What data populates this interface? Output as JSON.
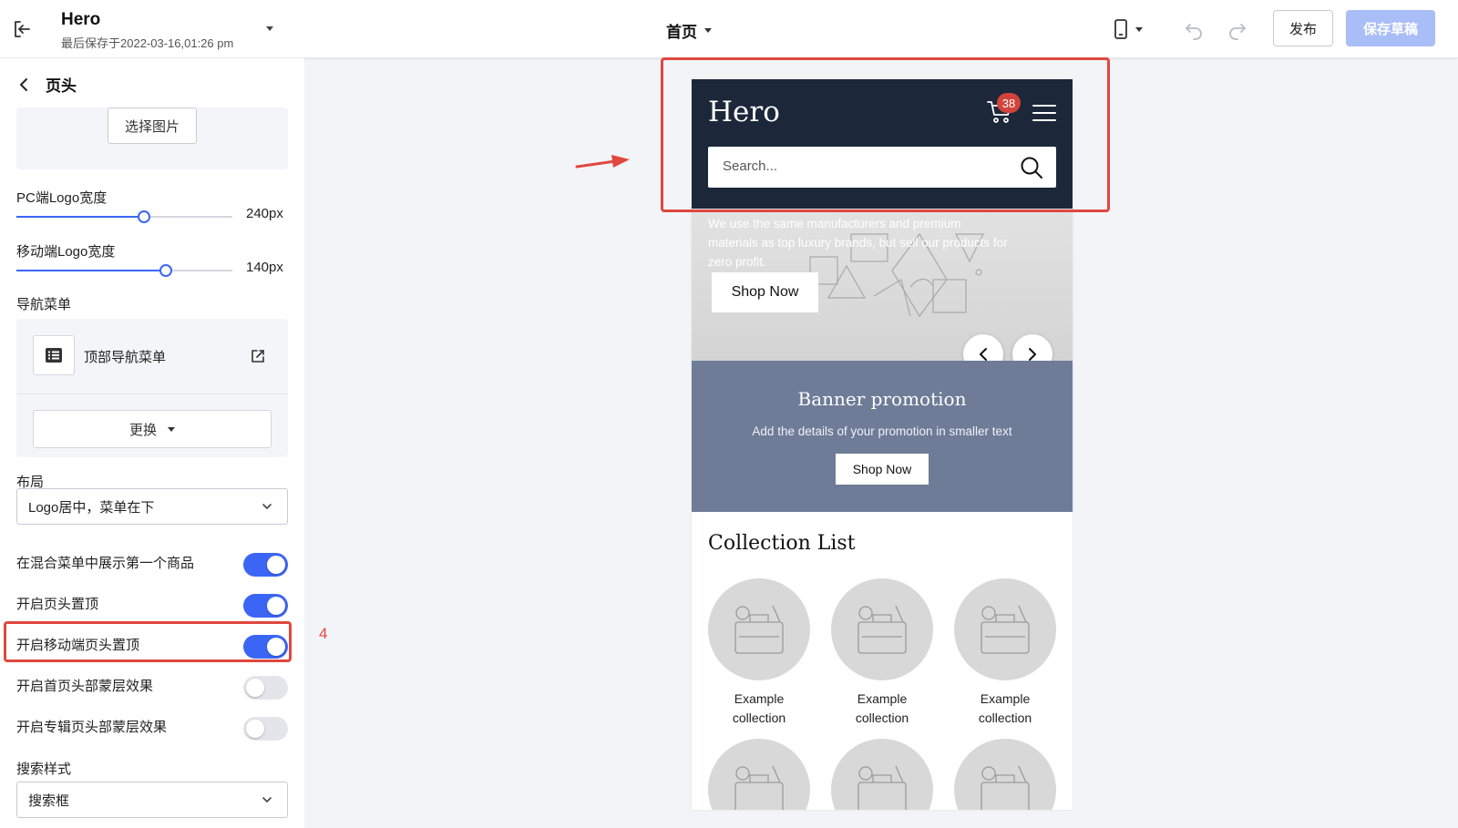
{
  "header": {
    "title": "Hero",
    "saved_text": "最后保存于2022-03-16,01:26 pm",
    "page_selector": "首页",
    "publish_label": "发布",
    "save_draft_label": "保存草稿"
  },
  "panel": {
    "title": "页头",
    "select_image_label": "选择图片",
    "pc_logo_width": {
      "label": "PC端Logo宽度",
      "value_text": "240px",
      "fraction": 0.59
    },
    "mobile_logo_width": {
      "label": "移动端Logo宽度",
      "value_text": "140px",
      "fraction": 0.69
    },
    "nav_menu": {
      "label": "导航菜单",
      "menu_name": "顶部导航菜单",
      "replace_label": "更换"
    },
    "layout": {
      "label": "布局",
      "value": "Logo居中，菜单在下"
    },
    "toggles": [
      {
        "label": "在混合菜单中展示第一个商品",
        "on": true
      },
      {
        "label": "开启页头置顶",
        "on": true
      },
      {
        "label": "开启移动端页头置顶",
        "on": true
      },
      {
        "label": "开启首页头部蒙层效果",
        "on": false
      },
      {
        "label": "开启专辑页头部蒙层效果",
        "on": false
      }
    ],
    "search_style": {
      "label": "搜索样式",
      "value": "搜索框"
    },
    "step_number": "4"
  },
  "preview": {
    "logo": "Hero",
    "cart_count": "38",
    "search_placeholder": "Search...",
    "hero_text": "We use the same manufacturers and premium materials as top luxury brands, but sell our products for zero profit.",
    "hero_button": "Shop Now",
    "banner_title": "Banner promotion",
    "banner_subtitle": "Add the details of your promotion in smaller text",
    "banner_button": "Shop Now",
    "collection_title": "Collection List",
    "collections": [
      {
        "label": "Example collection"
      },
      {
        "label": "Example collection"
      },
      {
        "label": "Example collection"
      }
    ]
  },
  "colors": {
    "accent": "#3b66f5",
    "annotation": "#e0473e",
    "preview_header": "#1c273a",
    "banner": "#6e7c98"
  }
}
